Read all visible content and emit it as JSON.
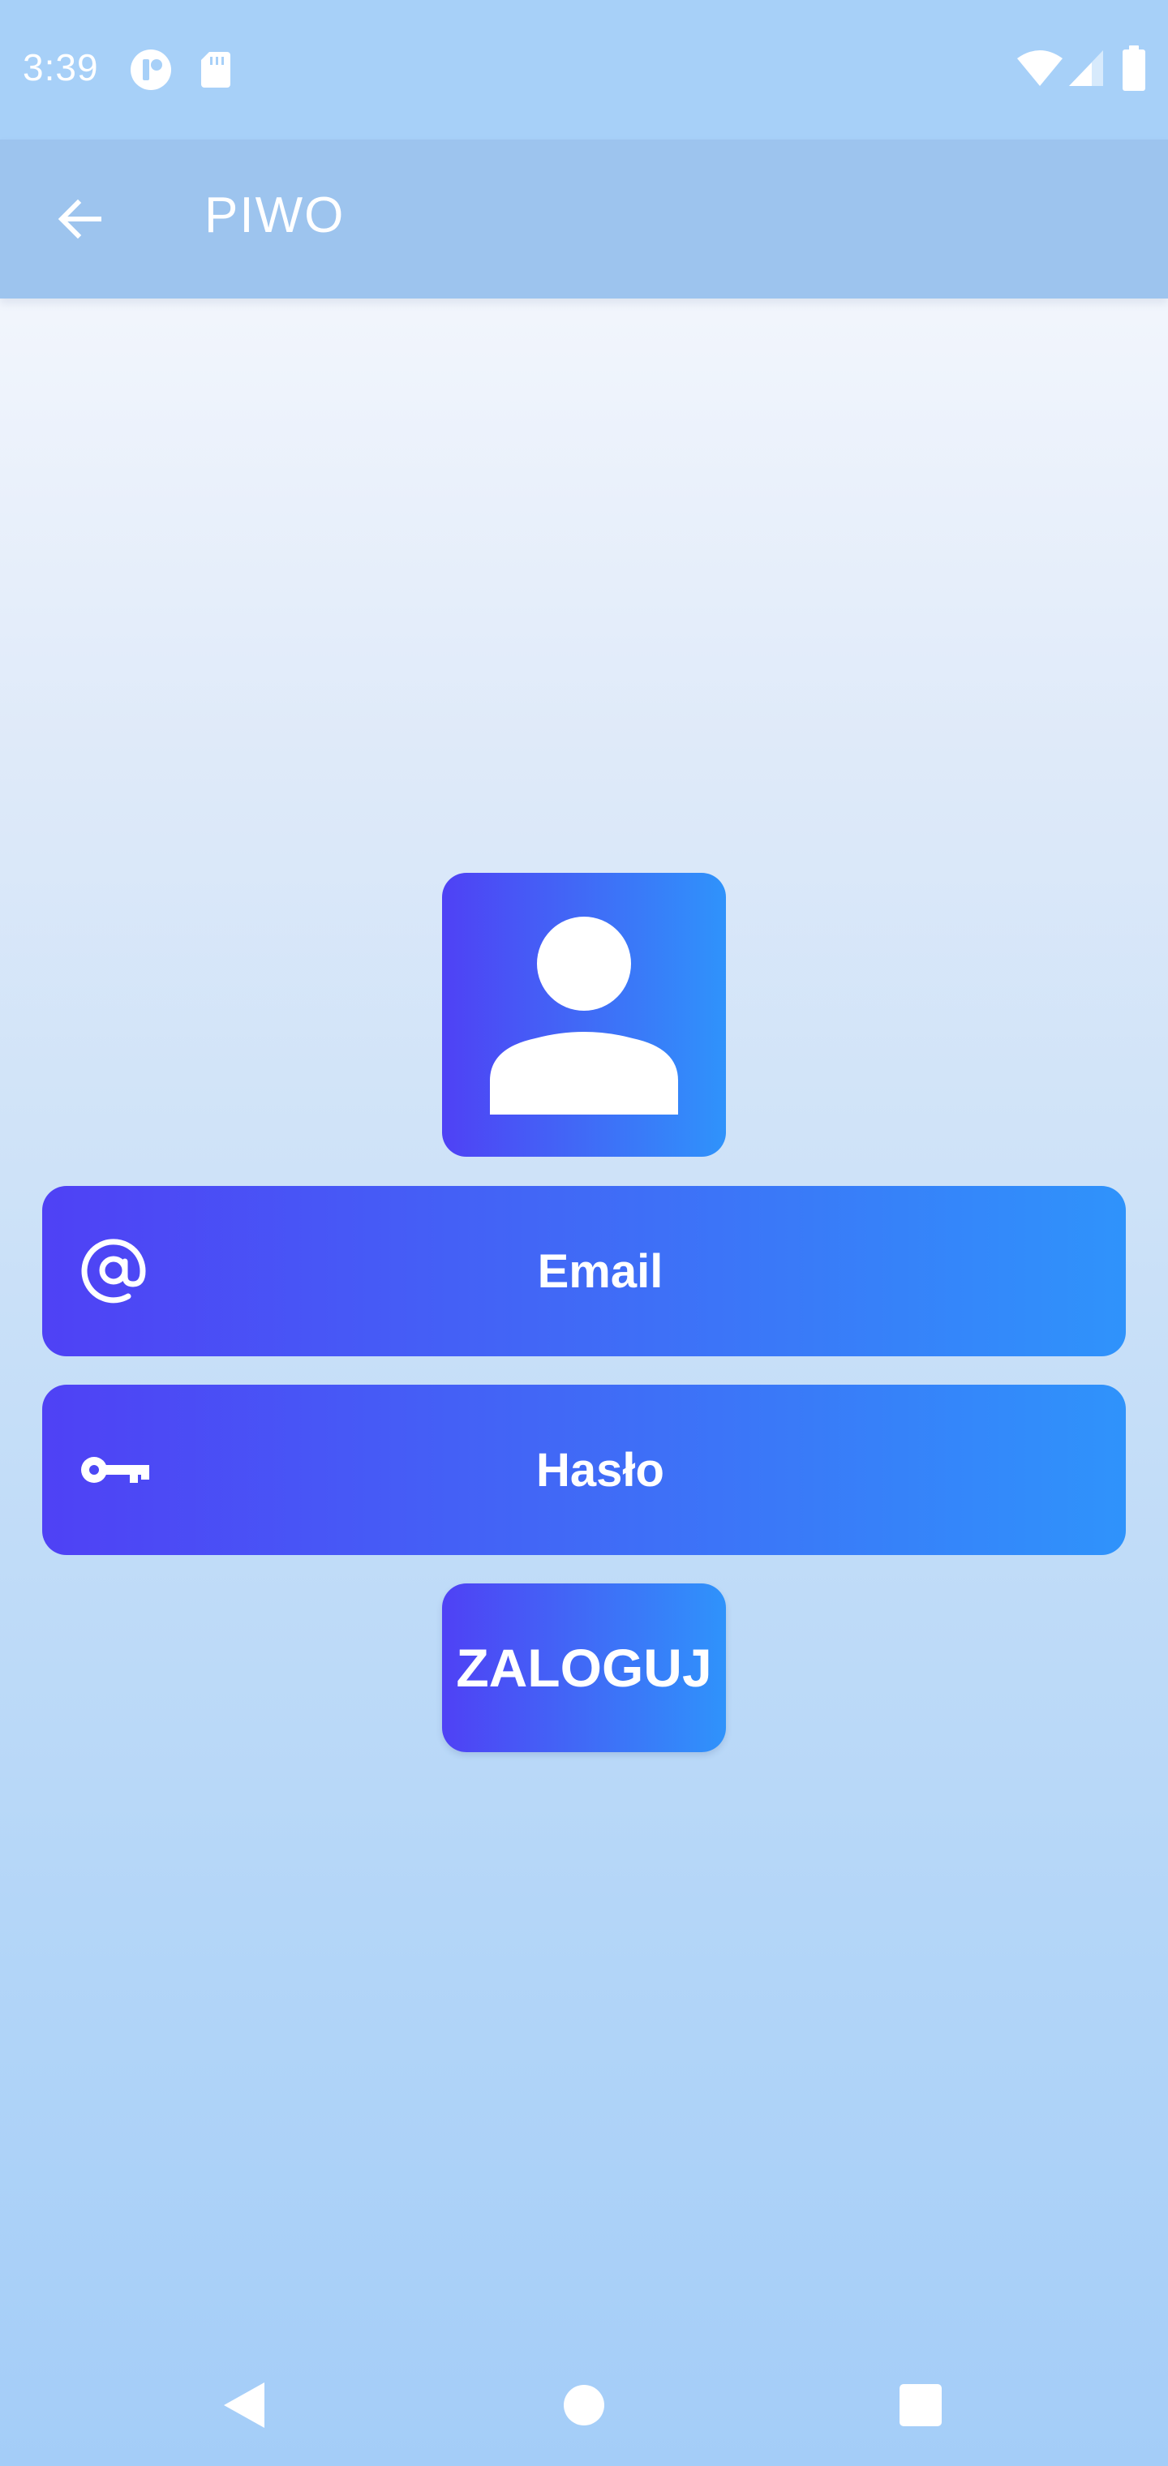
{
  "status_bar": {
    "time": "3:39",
    "icons": [
      "app-notification-icon",
      "sd-card-icon",
      "wifi-icon",
      "signal-icon",
      "battery-icon"
    ]
  },
  "app_bar": {
    "title": "PIWO",
    "back_icon": "arrow-back-icon"
  },
  "login_form": {
    "avatar_icon": "person-icon",
    "email": {
      "label": "Email",
      "icon": "at-sign-icon"
    },
    "password": {
      "label": "Hasło",
      "icon": "key-icon"
    },
    "submit_label": "ZALOGUJ"
  },
  "nav_bar": {
    "icons": [
      "nav-back-icon",
      "nav-home-icon",
      "nav-recents-icon"
    ]
  },
  "colors": {
    "gradient_start": "#4f41f5",
    "gradient_end": "#2f93fb",
    "status_bar_bg": "#a7d0f8",
    "app_bar_bg": "#9dc4ee",
    "text_on_accent": "#ffffff"
  }
}
